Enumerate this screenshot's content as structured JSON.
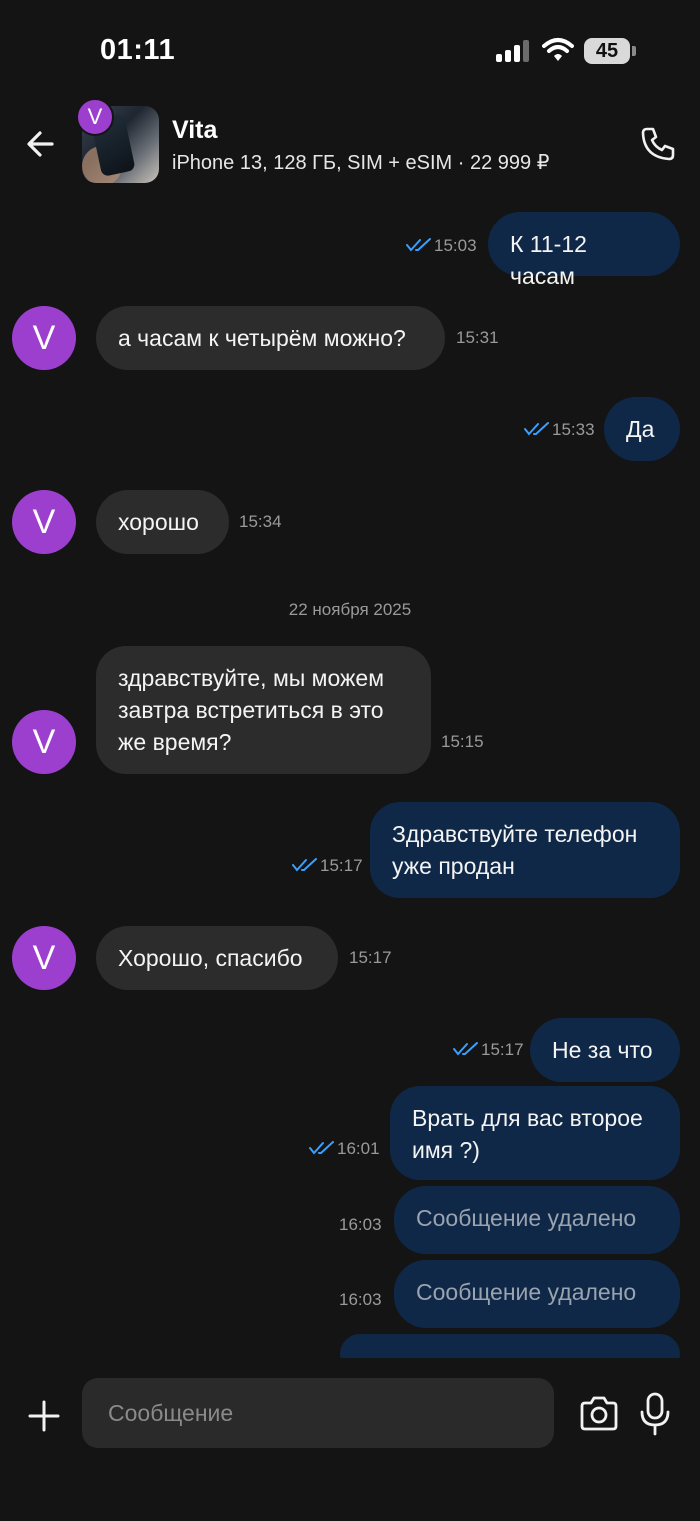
{
  "status_bar": {
    "time": "01:11",
    "battery": "45"
  },
  "header": {
    "contact_name": "Vita",
    "avatar_letter": "V",
    "subtitle": "iPhone 13, 128 ГБ, SIM + eSIM · 22 999 ₽"
  },
  "colors": {
    "background": "#141414",
    "incoming_bubble": "#2c2c2c",
    "outgoing_bubble": "#0f2848",
    "avatar": "#9c3fcf",
    "read_ticks": "#3aa0ff"
  },
  "messages": [
    {
      "direction": "out",
      "text": "К 11-12 часам",
      "time": "15:03",
      "read": true
    },
    {
      "direction": "in",
      "text": "а часам к четырём можно?",
      "time": "15:31",
      "avatar_letter": "V"
    },
    {
      "direction": "out",
      "text": "Да",
      "time": "15:33",
      "read": true
    },
    {
      "direction": "in",
      "text": "хорошо",
      "time": "15:34",
      "avatar_letter": "V"
    },
    {
      "type": "date",
      "text": "22 ноября 2025"
    },
    {
      "direction": "in",
      "text": "здравствуйте, мы можем завтра встретиться в это же время?",
      "time": "15:15",
      "avatar_letter": "V"
    },
    {
      "direction": "out",
      "text": "Здравствуйте телефон уже продан",
      "time": "15:17",
      "read": true
    },
    {
      "direction": "in",
      "text": "Хорошо, спасибо",
      "time": "15:17",
      "avatar_letter": "V"
    },
    {
      "direction": "out",
      "text": "Не за что",
      "time": "15:17",
      "read": true
    },
    {
      "direction": "out",
      "text": "Врать для вас второе имя ?)",
      "time": "16:01",
      "read": true
    },
    {
      "direction": "out",
      "text": "Сообщение удалено",
      "time": "16:03",
      "deleted": true
    },
    {
      "direction": "out",
      "text": "Сообщение удалено",
      "time": "16:03",
      "deleted": true
    }
  ],
  "composer": {
    "placeholder": "Сообщение"
  }
}
